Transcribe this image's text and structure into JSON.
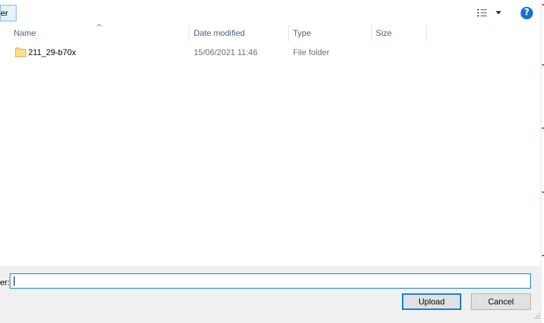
{
  "toolbar": {
    "new_folder_label": "er",
    "view_options_icon": "details-view-icon",
    "help_label": "?"
  },
  "columns": {
    "name": "Name",
    "date_modified": "Date modified",
    "type": "Type",
    "size": "Size"
  },
  "files": [
    {
      "name": "211_29-b70x",
      "date_modified": "15/06/2021 11:46",
      "type": "File folder",
      "size": "",
      "icon": "folder-icon"
    }
  ],
  "bottom": {
    "filename_label": "er:",
    "filename_value": "",
    "upload_label": "Upload",
    "cancel_label": "Cancel"
  },
  "colors": {
    "accent": "#0078d7",
    "folder": "#f7d874",
    "help": "#1a6fd1",
    "header_text": "#4c607a",
    "panel": "#f0f0f0"
  }
}
